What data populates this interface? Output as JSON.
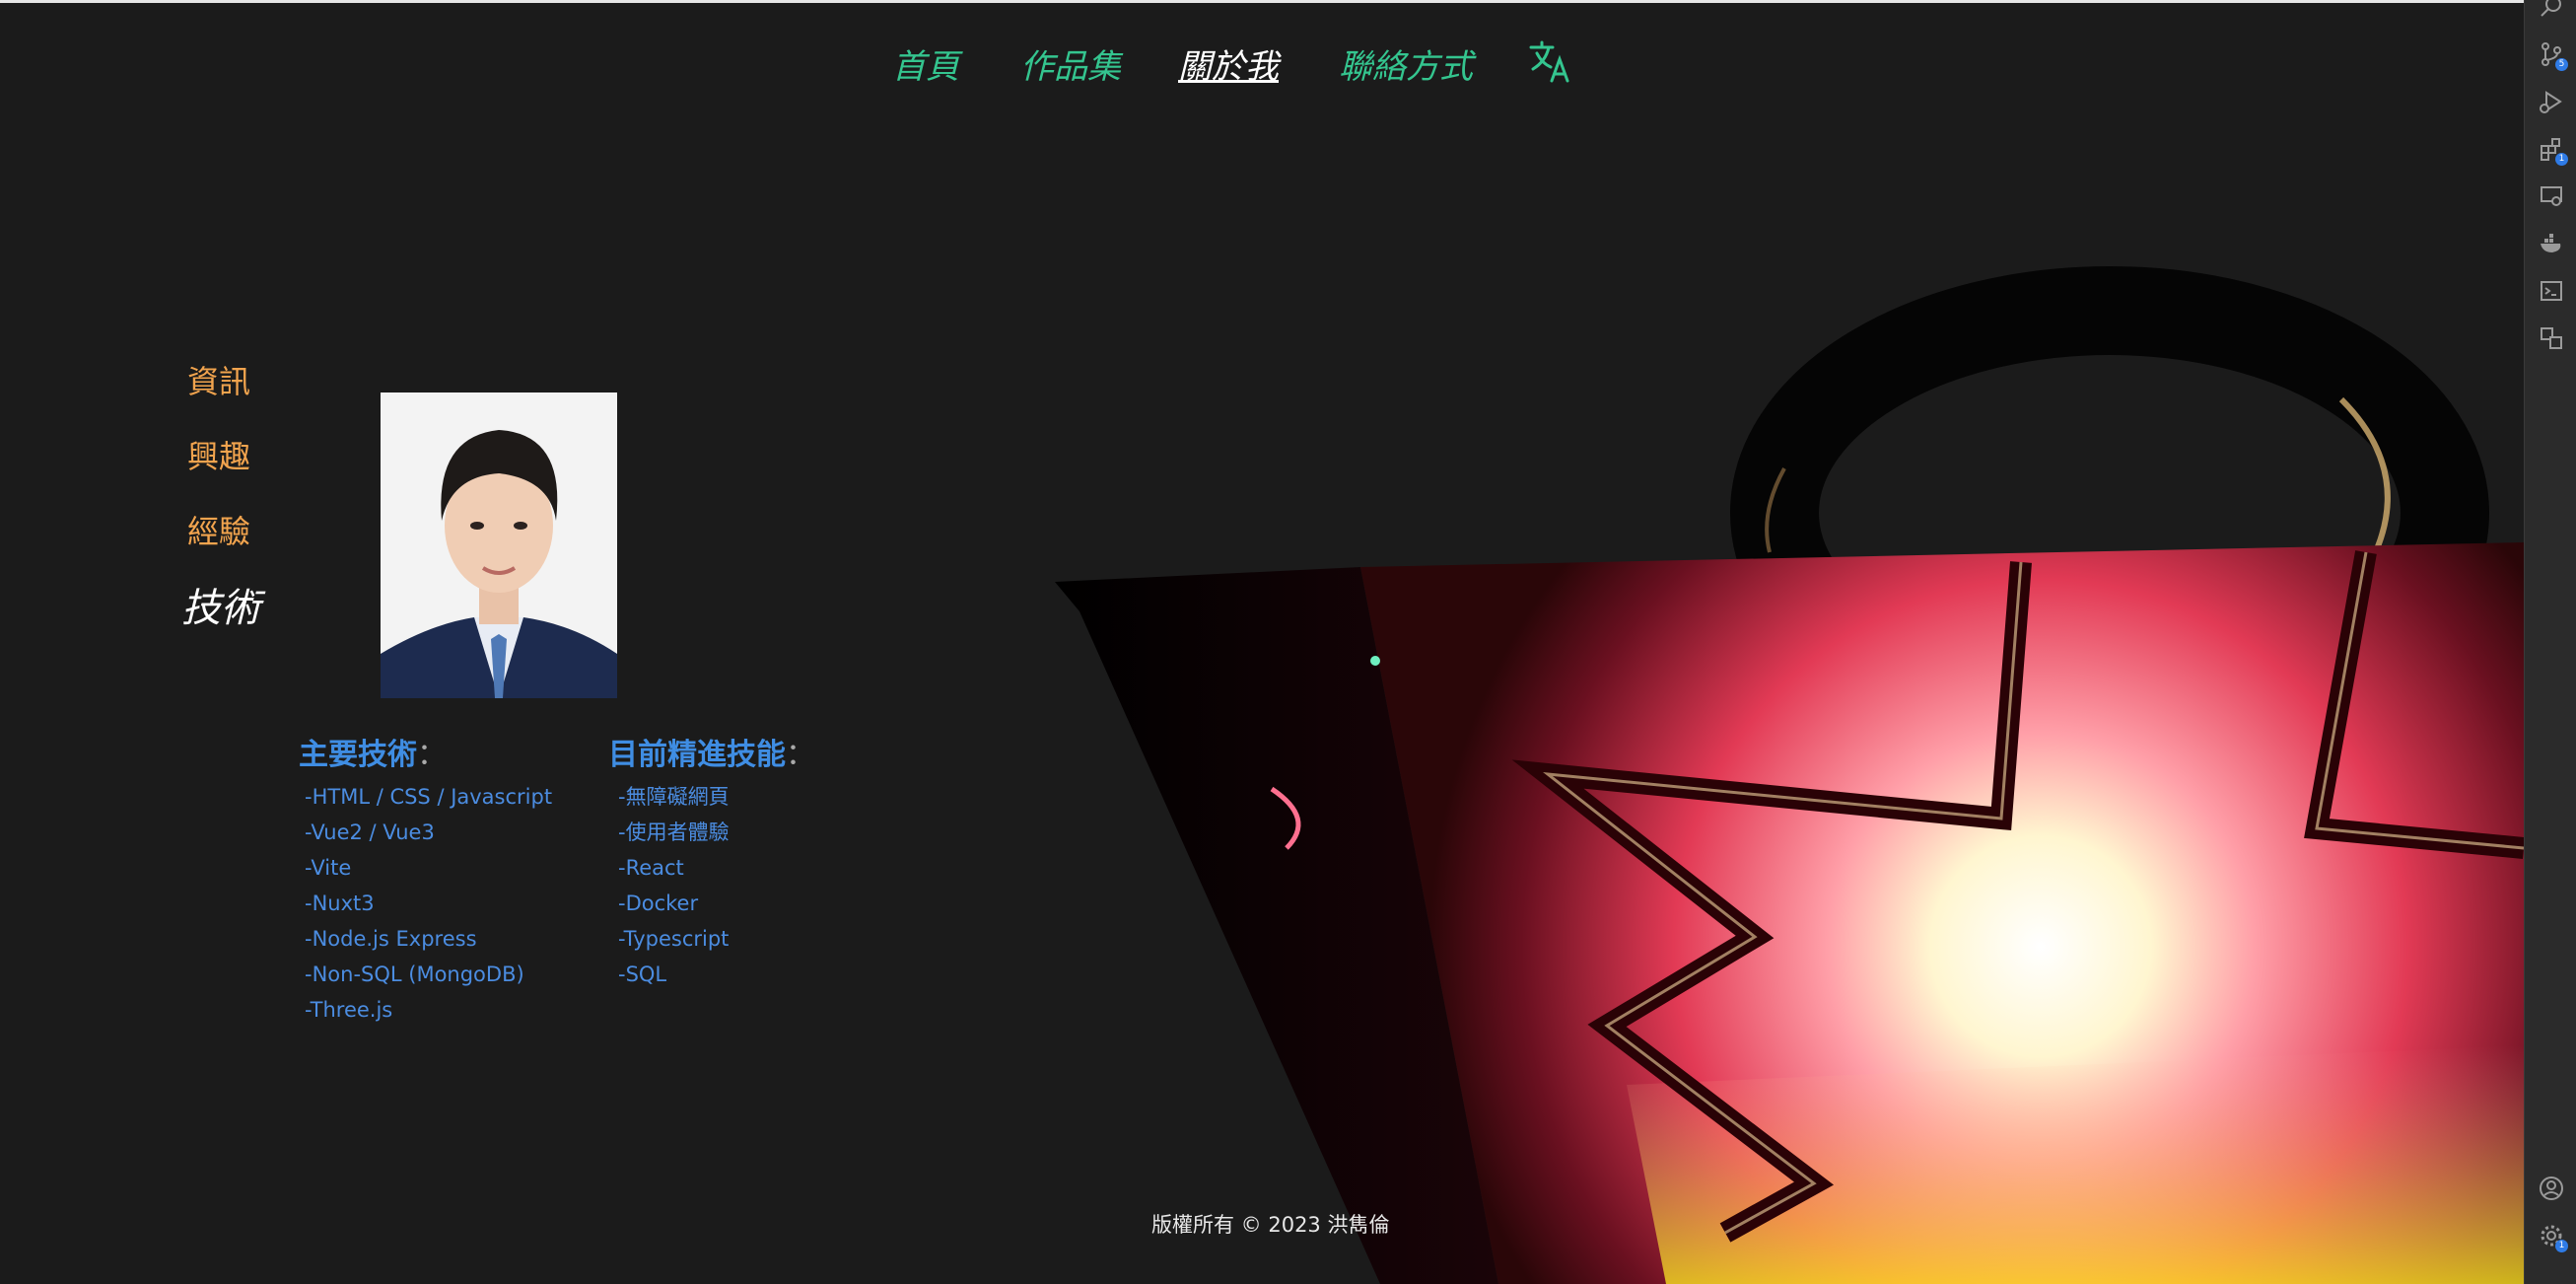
{
  "nav": {
    "items": [
      {
        "label": "首頁",
        "active": false
      },
      {
        "label": "作品集",
        "active": false
      },
      {
        "label": "關於我",
        "active": true
      },
      {
        "label": "聯絡方式",
        "active": false
      }
    ],
    "language_icon": "translate-icon"
  },
  "side_menu": {
    "items": [
      {
        "label": "資訊",
        "active": false
      },
      {
        "label": "興趣",
        "active": false
      },
      {
        "label": "經驗",
        "active": false
      },
      {
        "label": "技術",
        "active": true
      }
    ]
  },
  "skills": {
    "main": {
      "title": "主要技術",
      "colon": "：",
      "items": [
        "-HTML / CSS / Javascript",
        "-Vue2 / Vue3",
        "-Vite",
        "-Nuxt3",
        "-Node.js Express",
        "-Non-SQL (MongoDB)",
        "-Three.js"
      ]
    },
    "current": {
      "title": "目前精進技能",
      "colon": "：",
      "items": [
        "-無障礙網頁",
        "-使用者體驗",
        "-React",
        "-Docker",
        "-Typescript",
        "-SQL"
      ]
    }
  },
  "footer": {
    "text": "版權所有 © 2023 洪雋倫"
  },
  "activity_bar": {
    "icons": [
      "search-icon",
      "source-control-icon",
      "run-debug-icon",
      "extensions-icon",
      "remote-explorer-icon",
      "docker-icon",
      "terminal-icon",
      "translate-panel-icon",
      "account-icon",
      "settings-icon"
    ],
    "badges": {
      "source_control": "5",
      "extensions": "1",
      "settings": "1"
    }
  },
  "colors": {
    "nav": "#34c58f",
    "side_menu": "#f2a44e",
    "skill_title": "#3f8de3",
    "skill_item": "#4b8ce0",
    "background": "#1b1b1b"
  }
}
